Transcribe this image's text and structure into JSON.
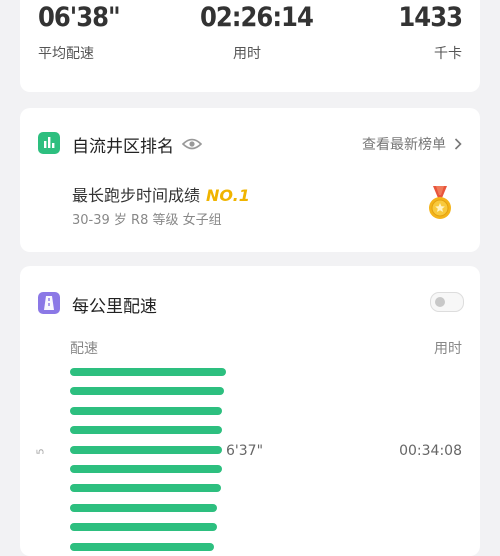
{
  "stats": [
    {
      "value": "06'38\"",
      "label": "平均配速"
    },
    {
      "value": "02:26:14",
      "label": "用时"
    },
    {
      "value": "1433",
      "label": "千卡"
    }
  ],
  "ranking": {
    "title": "自流井区排名",
    "link": "查看最新榜单",
    "record_title": "最长跑步时间成绩",
    "record_rank": "NO.1",
    "record_sub": "30-39 岁 R8 等级 女子组",
    "accent_color": "#2dbf7f",
    "medal_color": "#f0b400"
  },
  "pace": {
    "title": "每公里配速",
    "col_pace": "配速",
    "col_time": "用时",
    "km_marker": "5",
    "highlight_row": {
      "pace": "6'37\"",
      "time": "00:34:08"
    },
    "bar_color": "#2dbf7f",
    "bar_levels": [
      0.96,
      0.95,
      0.94,
      0.94,
      0.94,
      0.94,
      0.93,
      0.91,
      0.91,
      0.89
    ]
  }
}
